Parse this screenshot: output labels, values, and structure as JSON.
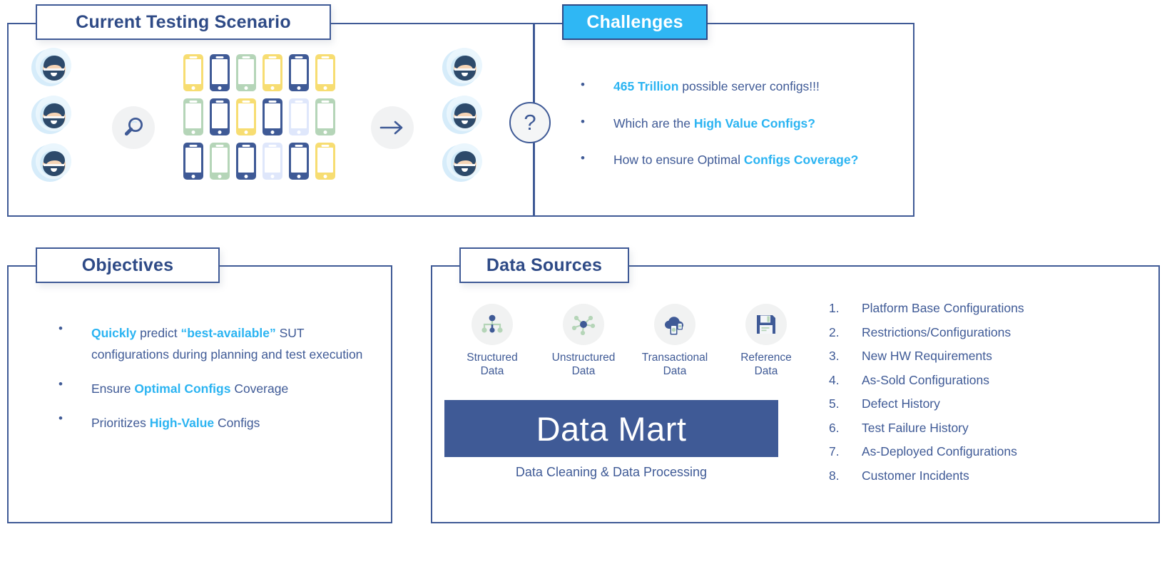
{
  "panels": {
    "scenario": {
      "title": "Current Testing Scenario"
    },
    "challenges": {
      "title": "Challenges",
      "accent_color": "#2fb7f4",
      "bullets": [
        {
          "bullet": "•",
          "pre": "",
          "highlight": "465 Trillion",
          "post": " possible server configs!!!",
          "tail_highlight": ""
        },
        {
          "bullet": "•",
          "pre": "Which are the ",
          "highlight": "High Value Configs?",
          "post": "",
          "tail_highlight": ""
        },
        {
          "bullet": "•",
          "pre": "How to ensure Optimal ",
          "highlight": "Configs Coverage?",
          "post": "",
          "tail_highlight": ""
        }
      ]
    },
    "objectives": {
      "title": "Objectives",
      "bullets": [
        {
          "bullet": "•",
          "pre": "",
          "highlight": "Quickly",
          "mid": " predict ",
          "highlight2": "“best-available”",
          "post": " SUT configurations during planning and test execution"
        },
        {
          "bullet": "•",
          "pre": "Ensure ",
          "highlight": "Optimal Configs",
          "mid": " Coverage",
          "highlight2": "",
          "post": ""
        },
        {
          "bullet": "•",
          "pre": "Prioritizes ",
          "highlight": "High-Value",
          "mid": " Configs",
          "highlight2": "",
          "post": ""
        }
      ]
    },
    "datasources": {
      "title": "Data Sources",
      "sources": [
        {
          "label_line1": "Structured",
          "label_line2": "Data",
          "icon": "hierarchy-icon"
        },
        {
          "label_line1": "Unstructured",
          "label_line2": "Data",
          "icon": "network-node-icon"
        },
        {
          "label_line1": "Transactional",
          "label_line2": "Data",
          "icon": "cloud-money-icon"
        },
        {
          "label_line1": "Reference",
          "label_line2": "Data",
          "icon": "floppy-disk-icon"
        }
      ],
      "datamart_label": "Data Mart",
      "datamart_caption": "Data Cleaning & Data Processing",
      "datamart_color": "#3f5a96",
      "numbered_items": [
        {
          "index": "1.",
          "text": "Platform Base Configurations"
        },
        {
          "index": "2.",
          "text": "Restrictions/Configurations"
        },
        {
          "index": "3.",
          "text": "New HW Requirements"
        },
        {
          "index": "4.",
          "text": "As-Sold Configurations"
        },
        {
          "index": "5.",
          "text": "Defect History"
        },
        {
          "index": "6.",
          "text": "Test Failure History"
        },
        {
          "index": "7.",
          "text": "As-Deployed Configurations"
        },
        {
          "index": "8.",
          "text": "Customer Incidents"
        }
      ]
    }
  },
  "diagram": {
    "question_mark": "?",
    "left_avatars": 3,
    "right_avatars": 3,
    "search_icon": "magnifier-icon",
    "flow_arrow_icon": "arrow-right-icon",
    "phone_colors": [
      [
        "#f7dd72",
        "#3f5a96",
        "#b5d5b8",
        "#f7dd72",
        "#3f5a96",
        "#f7dd72"
      ],
      [
        "#b5d5b8",
        "#3f5a96",
        "#f7dd72",
        "#3f5a96",
        "#dfe7fb",
        "#b5d5b8"
      ],
      [
        "#3f5a96",
        "#b5d5b8",
        "#3f5a96",
        "#dfe7fb",
        "#3f5a96",
        "#f7dd72"
      ]
    ]
  },
  "theme": {
    "border_blue": "#3f5a96",
    "text_blue": "#3f5a96",
    "accent_cyan": "#2bb4f2",
    "title_blue": "#2e4a86",
    "icon_bg": "#f1f2f2",
    "green": "#b5d5b8"
  }
}
